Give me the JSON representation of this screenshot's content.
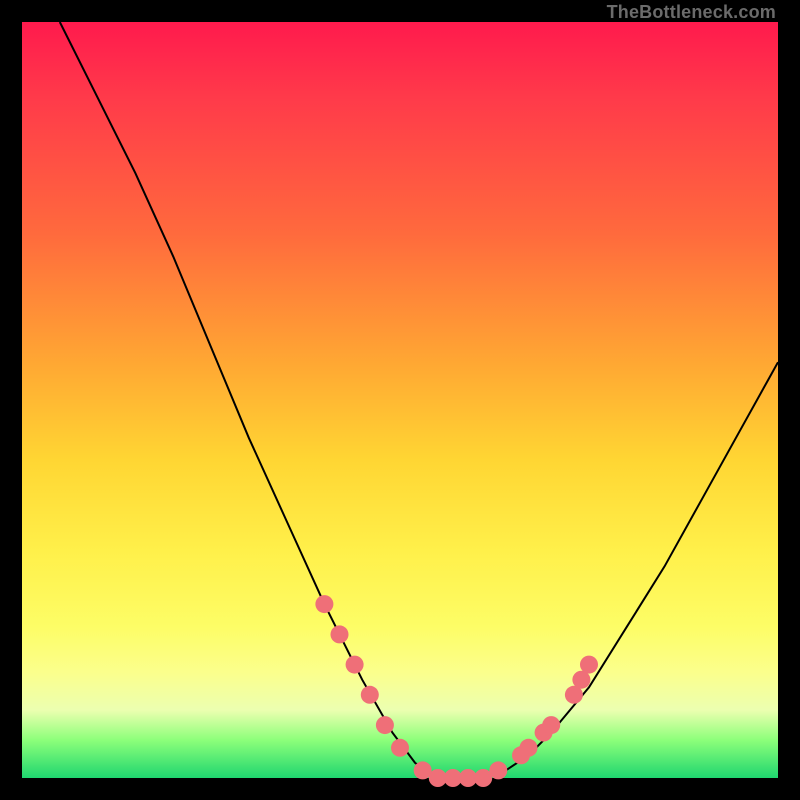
{
  "watermark": {
    "text": "TheBottleneck.com"
  },
  "colors": {
    "curve_stroke": "#000000",
    "marker_fill": "#ef6f78",
    "marker_stroke": "#ef6f78",
    "background": "#000000",
    "gradient_top": "#ff1a4d",
    "gradient_bottom": "#1fd66f"
  },
  "chart_data": {
    "type": "line",
    "title": "",
    "xlabel": "",
    "ylabel": "",
    "xlim": [
      0,
      100
    ],
    "ylim": [
      0,
      100
    ],
    "grid": false,
    "legend": false,
    "series": [
      {
        "name": "bottleneck-curve",
        "x": [
          5,
          10,
          15,
          20,
          25,
          30,
          35,
          40,
          45,
          49,
          52,
          55,
          58,
          61,
          64,
          67,
          70,
          75,
          80,
          85,
          90,
          95,
          100
        ],
        "y": [
          100,
          90,
          80,
          69,
          57,
          45,
          34,
          23,
          13,
          6,
          2,
          0,
          0,
          0,
          1,
          3,
          6,
          12,
          20,
          28,
          37,
          46,
          55
        ]
      }
    ],
    "markers": [
      {
        "x": 40,
        "y": 23
      },
      {
        "x": 42,
        "y": 19
      },
      {
        "x": 44,
        "y": 15
      },
      {
        "x": 46,
        "y": 11
      },
      {
        "x": 48,
        "y": 7
      },
      {
        "x": 50,
        "y": 4
      },
      {
        "x": 53,
        "y": 1
      },
      {
        "x": 55,
        "y": 0
      },
      {
        "x": 57,
        "y": 0
      },
      {
        "x": 59,
        "y": 0
      },
      {
        "x": 61,
        "y": 0
      },
      {
        "x": 63,
        "y": 1
      },
      {
        "x": 66,
        "y": 3
      },
      {
        "x": 67,
        "y": 4
      },
      {
        "x": 69,
        "y": 6
      },
      {
        "x": 70,
        "y": 7
      },
      {
        "x": 73,
        "y": 11
      },
      {
        "x": 74,
        "y": 13
      },
      {
        "x": 75,
        "y": 15
      }
    ],
    "notes": "x is arbitrary horizontal position (0-100 across plot width); y is percentage bottleneck severity (0 at bottom/green, 100 at top/red). Curve is a V shape with minimum near x≈55-62. Markers cluster along the lower portion of the V on both descending-left and ascending-right branches."
  }
}
